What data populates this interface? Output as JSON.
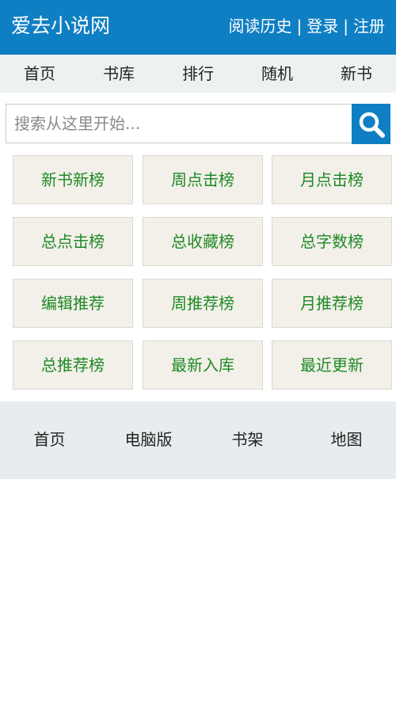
{
  "header": {
    "title": "爱去小说网",
    "links": [
      "阅读历史",
      "登录",
      "注册"
    ],
    "separator": "|"
  },
  "nav": {
    "items": [
      "首页",
      "书库",
      "排行",
      "随机",
      "新书"
    ]
  },
  "search": {
    "placeholder": "搜索从这里开始...",
    "value": "",
    "button_icon": "search-icon"
  },
  "rank_buttons": [
    "新书新榜",
    "周点击榜",
    "月点击榜",
    "总点击榜",
    "总收藏榜",
    "总字数榜",
    "编辑推荐",
    "周推荐榜",
    "月推荐榜",
    "总推荐榜",
    "最新入库",
    "最近更新"
  ],
  "footer": {
    "items": [
      "首页",
      "电脑版",
      "书架",
      "地图"
    ]
  },
  "colors": {
    "brand_blue": "#0f7fc3",
    "grid_text_green": "#1f8a24",
    "grid_bg": "#f3f0ea",
    "nav_bg": "#eef1f2"
  }
}
